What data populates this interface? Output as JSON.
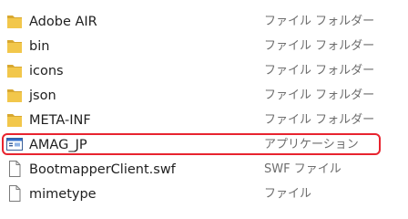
{
  "colors": {
    "folder": "#f2c74b",
    "folder_dark": "#d8a830",
    "app_icon_border": "#3a5f98",
    "app_icon_bar": "#2f6cc9",
    "highlight": "#e8242f",
    "type_text": "#6d6d6d"
  },
  "files": [
    {
      "name": "Adobe AIR",
      "type": "ファイル フォルダー",
      "icon": "folder-icon"
    },
    {
      "name": "bin",
      "type": "ファイル フォルダー",
      "icon": "folder-icon"
    },
    {
      "name": "icons",
      "type": "ファイル フォルダー",
      "icon": "folder-icon"
    },
    {
      "name": "json",
      "type": "ファイル フォルダー",
      "icon": "folder-icon"
    },
    {
      "name": "META-INF",
      "type": "ファイル フォルダー",
      "icon": "folder-icon"
    },
    {
      "name": "AMAG_JP",
      "type": "アプリケーション",
      "icon": "application-icon",
      "highlighted": true
    },
    {
      "name": "BootmapperClient.swf",
      "type": "SWF ファイル",
      "icon": "file-icon"
    },
    {
      "name": "mimetype",
      "type": "ファイル",
      "icon": "file-icon"
    }
  ]
}
